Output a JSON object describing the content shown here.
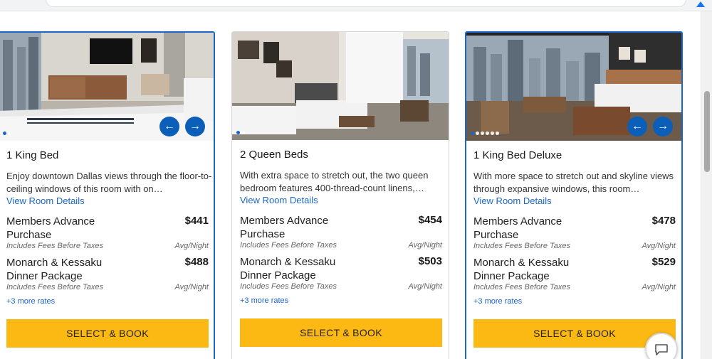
{
  "browser": {
    "menu_icon": "chrome-menu-icon"
  },
  "cards": [
    {
      "title": "1 King Bed",
      "description": "Enjoy downtown Dallas views through the floor-to-ceiling windows of this room with on…",
      "view_details": "View Room Details",
      "rates": [
        {
          "name": "Members Advance Purchase",
          "price": "$441",
          "fees": "Includes Fees Before Taxes",
          "unit": "Avg/Night"
        },
        {
          "name": "Monarch & Kessaku Dinner Package",
          "price": "$488",
          "fees": "Includes Fees Before Taxes",
          "unit": "Avg/Night"
        }
      ],
      "more_rates": "+3 more rates",
      "book_label": "SELECT & BOOK",
      "image_count": 2,
      "active_image": 1,
      "prev_arrow": "←",
      "next_arrow": "→"
    },
    {
      "title": "2 Queen Beds",
      "description": "With extra space to stretch out, the two queen bedroom features 400-thread-count linens,…",
      "view_details": "View Room Details",
      "rates": [
        {
          "name": "Members Advance Purchase",
          "price": "$454",
          "fees": "Includes Fees Before Taxes",
          "unit": "Avg/Night"
        },
        {
          "name": "Monarch & Kessaku Dinner Package",
          "price": "$503",
          "fees": "Includes Fees Before Taxes",
          "unit": "Avg/Night"
        }
      ],
      "more_rates": "+3 more rates",
      "book_label": "SELECT & BOOK",
      "image_count": 2,
      "active_image": 1
    },
    {
      "title": "1 King Bed Deluxe",
      "description": "With more space to stretch out and skyline views through expansive windows, this room…",
      "view_details": "View Room Details",
      "rates": [
        {
          "name": "Members Advance Purchase",
          "price": "$478",
          "fees": "Includes Fees Before Taxes",
          "unit": "Avg/Night"
        },
        {
          "name": "Monarch & Kessaku Dinner Package",
          "price": "$529",
          "fees": "Includes Fees Before Taxes",
          "unit": "Avg/Night"
        }
      ],
      "more_rates": "+3 more rates",
      "book_label": "SELECT & BOOK",
      "image_count": 6,
      "active_image": 1,
      "prev_arrow": "←",
      "next_arrow": "→"
    }
  ],
  "colors": {
    "accent_blue": "#1b66c9",
    "arrow_blue": "#0b5fb8",
    "book_yellow": "#fdb913"
  },
  "chat_icon": "chat-bubble-icon"
}
